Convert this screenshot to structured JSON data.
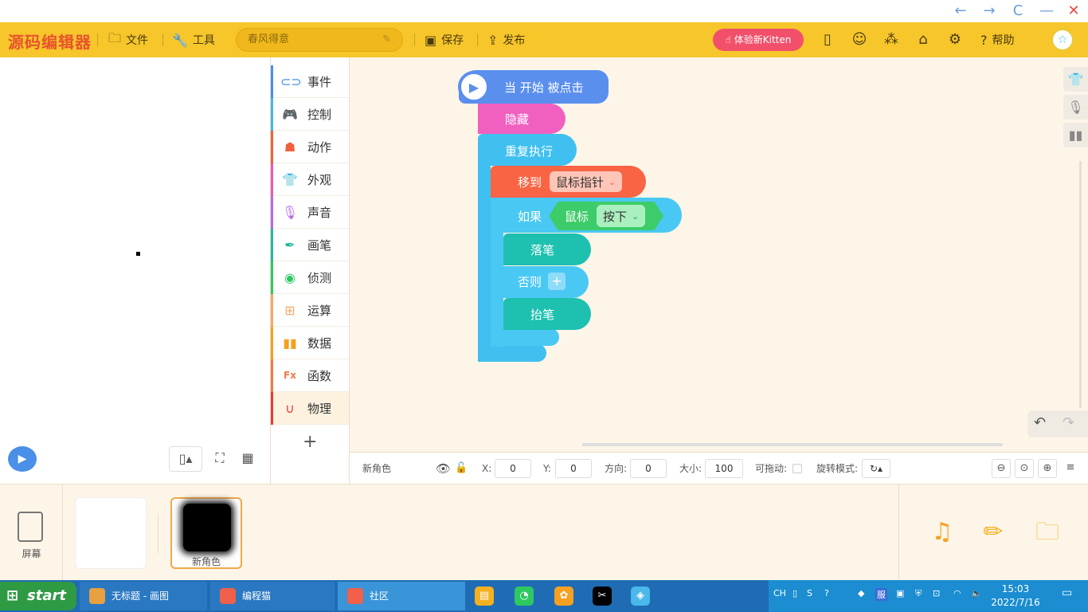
{
  "window": {
    "back": "←",
    "forward": "→",
    "refresh": "C",
    "minimize": "—",
    "close": "✕"
  },
  "toolbar": {
    "logo": "源码编辑器",
    "file": "文件",
    "tools": "工具",
    "project_name": "春风得意",
    "save": "保存",
    "publish": "发布",
    "kitten": "体验新Kitten",
    "help": "帮助"
  },
  "categories": [
    {
      "label": "事件",
      "icon": "toggle-icon",
      "color": "#4a8fe8"
    },
    {
      "label": "控制",
      "icon": "gamepad-icon",
      "color": "#3fb8e8"
    },
    {
      "label": "动作",
      "icon": "ghost-icon",
      "color": "#f0603a"
    },
    {
      "label": "外观",
      "icon": "shirt-icon",
      "color": "#e85ab8"
    },
    {
      "label": "声音",
      "icon": "mic-icon",
      "color": "#b36ae8"
    },
    {
      "label": "画笔",
      "icon": "pen-icon",
      "color": "#1fb8a0"
    },
    {
      "label": "侦测",
      "icon": "radar-icon",
      "color": "#2ec860"
    },
    {
      "label": "运算",
      "icon": "calculator-icon",
      "color": "#f5a86a"
    },
    {
      "label": "数据",
      "icon": "bar-chart-icon",
      "color": "#f5a020"
    },
    {
      "label": "函数",
      "icon": "function-icon",
      "color": "#f07a4a"
    },
    {
      "label": "物理",
      "icon": "magnet-icon",
      "color": "#e83a3a"
    }
  ],
  "blocks": {
    "start": "当 开始 被点击",
    "hide": "隐藏",
    "repeat": "重复执行",
    "move_to": "移到",
    "move_target": "鼠标指针",
    "if": "如果",
    "mouse": "鼠标",
    "mouse_state": "按下",
    "pen_down": "落笔",
    "else": "否则",
    "else_add": "+",
    "pen_up": "抬笔"
  },
  "props": {
    "sprite_name": "新角色",
    "x_label": "X:",
    "x": "0",
    "y_label": "Y:",
    "y": "0",
    "dir_label": "方向:",
    "dir": "0",
    "size_label": "大小:",
    "size": "100",
    "drag_label": "可拖动:",
    "rot_label": "旋转模式:"
  },
  "sprites": {
    "screen_label": "屏幕",
    "sprite2_label": "新角色"
  },
  "taskbar": {
    "start": "start",
    "paint": "无标题 - 画图",
    "codecat": "编程猫",
    "community": "社区",
    "ime": "CH",
    "tray_service": "服",
    "time": "15:03",
    "date": "2022/7/16"
  }
}
